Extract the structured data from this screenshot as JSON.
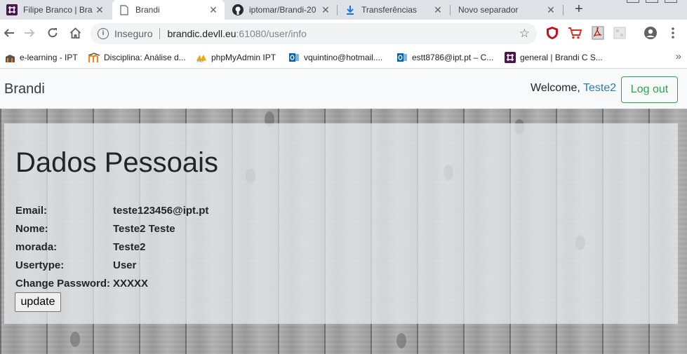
{
  "browser": {
    "tabs": [
      {
        "label": "Filipe Branco | Bra",
        "icon": "slack-icon",
        "active": false
      },
      {
        "label": "Brandi",
        "icon": "page-icon",
        "active": true
      },
      {
        "label": "iptomar/Brandi-20",
        "icon": "github-icon",
        "active": false
      },
      {
        "label": "Transferências",
        "icon": "download-icon",
        "active": false
      },
      {
        "label": "Novo separador",
        "icon": "",
        "active": false
      }
    ],
    "new_tab": "+",
    "address": {
      "security_label": "Inseguro",
      "host": "brandic.devll.eu",
      "path": ":61080/user/info"
    },
    "bookmarks": [
      {
        "label": "e-learning - IPT",
        "icon": "moodle-icon"
      },
      {
        "label": "Disciplina: Análise d...",
        "icon": "moodle-icon"
      },
      {
        "label": "phpMyAdmin IPT",
        "icon": "phpmyadmin-icon"
      },
      {
        "label": "vquintino@hotmail....",
        "icon": "outlook-icon"
      },
      {
        "label": "estt8786@ipt.pt – C...",
        "icon": "outlook-icon"
      },
      {
        "label": "general | Brandi C S...",
        "icon": "slack-icon"
      }
    ],
    "bookmarks_more": "»"
  },
  "app": {
    "brand": "Brandi",
    "welcome_prefix": "Welcome, ",
    "username": "Teste2",
    "logout_label": "Log out"
  },
  "profile": {
    "title": "Dados Pessoais",
    "rows": [
      {
        "label": "Email:",
        "value": "teste123456@ipt.pt"
      },
      {
        "label": "Nome:",
        "value": "Teste2 Teste"
      },
      {
        "label": "morada:",
        "value": "Teste2"
      },
      {
        "label": "Usertype:",
        "value": "User"
      },
      {
        "label": "Change Password:",
        "value": "XXXXX"
      }
    ],
    "update_label": "update"
  },
  "colors": {
    "logout_green": "#28a745",
    "link_blue": "#2a7ab8",
    "navbar_bg": "#f8f9fa",
    "tabstrip_bg": "#dee1e6"
  }
}
